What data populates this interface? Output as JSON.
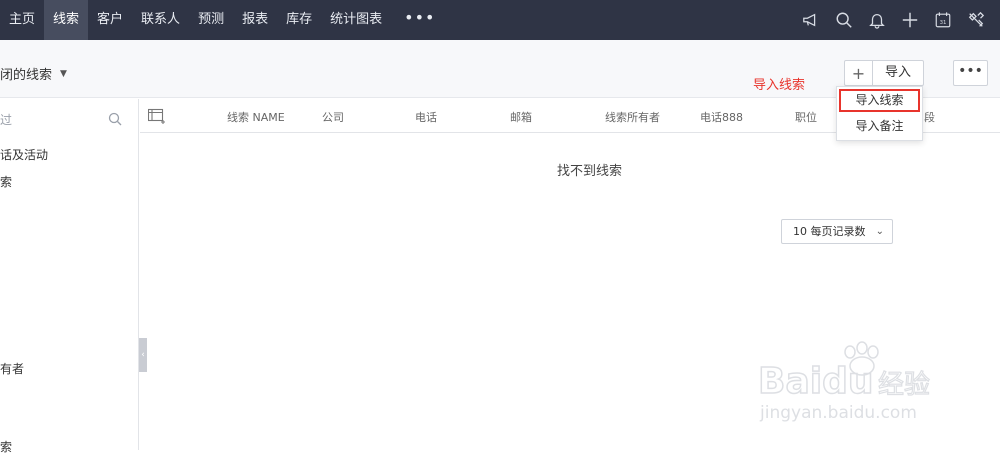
{
  "nav": {
    "items": [
      {
        "label": "主页",
        "active": false
      },
      {
        "label": "线索",
        "active": true
      },
      {
        "label": "客户",
        "active": false
      },
      {
        "label": "联系人",
        "active": false
      },
      {
        "label": "预测",
        "active": false
      },
      {
        "label": "报表",
        "active": false
      },
      {
        "label": "库存",
        "active": false
      },
      {
        "label": "统计图表",
        "active": false
      }
    ],
    "more_label": "•••",
    "icons": [
      "announcement-icon",
      "search-icon",
      "bell-icon",
      "plus-icon",
      "calendar-icon",
      "tools-icon"
    ],
    "calendar_day": "31"
  },
  "header": {
    "view_name": "闭的线索",
    "import_annotation": "导入线索",
    "plus_label": "+",
    "import_label": "导入",
    "more_label": "•••"
  },
  "dropdown": {
    "items": [
      "导入线索",
      "导入备注"
    ]
  },
  "sidebar": {
    "filter_placeholder": "过",
    "items": [
      "话及活动",
      "索",
      "有者",
      "索"
    ]
  },
  "table": {
    "columns": [
      "线索 NAME",
      "公司",
      "电话",
      "邮箱",
      "线索所有者",
      "电话888",
      "职位",
      "段"
    ],
    "empty_message": "找不到线索",
    "page_size_label": "10 每页记录数"
  },
  "watermark": {
    "brand": "Baidu",
    "brand_cn": "经验",
    "url": "jingyan.baidu.com"
  },
  "colors": {
    "topbar": "#2f3445",
    "accent_red": "#e8342c"
  }
}
